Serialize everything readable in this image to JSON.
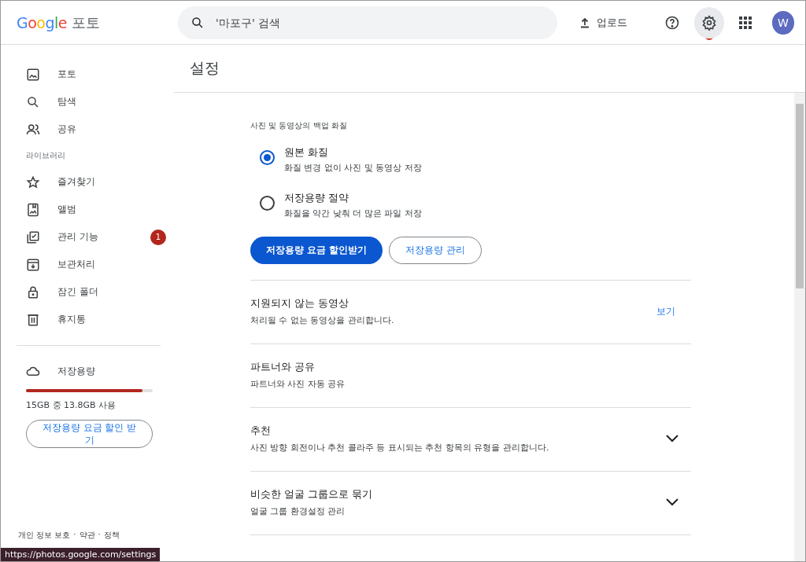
{
  "header": {
    "logo": {
      "brand": "Google",
      "product": "포토"
    },
    "search": {
      "placeholder": "'마포구' 검색"
    },
    "upload": "업로드",
    "icon_buttons": [
      {
        "kind": "help",
        "selected": false
      },
      {
        "kind": "settings",
        "selected": true
      },
      {
        "kind": "apps",
        "selected": false
      }
    ],
    "avatar": "W"
  },
  "sidebar": {
    "items": [
      {
        "kind": "photo",
        "label": "포토",
        "selected": false
      },
      {
        "kind": "search",
        "label": "탐색",
        "selected": false
      },
      {
        "kind": "people",
        "label": "공유",
        "selected": false
      }
    ],
    "library_label": "라이브러리",
    "library_items": [
      {
        "kind": "star",
        "label": "즐겨찾기",
        "selected": false
      },
      {
        "kind": "album",
        "label": "앨범",
        "selected": false
      },
      {
        "kind": "check",
        "label": "관리 기능",
        "selected": false,
        "badge": "1"
      },
      {
        "kind": "archive",
        "label": "보관처리",
        "selected": false
      },
      {
        "kind": "lock",
        "label": "잠긴 폴더",
        "selected": false
      },
      {
        "kind": "trash",
        "label": "휴지통",
        "selected": false
      }
    ],
    "storage": {
      "label": "저장용량",
      "level": 0.92,
      "usage": "15GB 중 13.8GB 사용",
      "button": "저장용량 요금 할인 받기"
    },
    "footer": {
      "links": [
        "개인 정보 보호",
        "약관",
        "정책"
      ],
      "separator": "·"
    }
  },
  "main": {
    "title": "설정",
    "backup": {
      "label": "사진 및 동영상의 백업 화질",
      "options": [
        {
          "title": "원본 화질",
          "description": "화질 변경 없이 사진 및 동영상 저장",
          "selected": true
        },
        {
          "title": "저장용량 절약",
          "description": "화질을 약간 낮춰 더 많은 파일 저장",
          "selected": false
        }
      ],
      "buttons": [
        {
          "kind": "primary",
          "label": "저장용량 요금 할인받기"
        },
        {
          "kind": "outlined",
          "label": "저장용량 관리"
        }
      ]
    },
    "rows": [
      {
        "title": "지원되지 않는 동영상",
        "description": "처리될 수 없는 동영상을 관리합니다.",
        "action": {
          "kind": "link",
          "label": "보기"
        }
      },
      {
        "title": "파트너와 공유",
        "description": "파트너와 사진 자동 공유"
      },
      {
        "title": "추천",
        "description": "사진 방향 회전이나 추천 콜라주 등 표시되는 추천 항목의 유형을 관리합니다.",
        "action": {
          "kind": "expand",
          "expanded": false
        }
      },
      {
        "title": "비슷한 얼굴 그룹으로 묶기",
        "description": "얼굴 그룹 환경설정 관리",
        "action": {
          "kind": "expand",
          "expanded": false
        }
      }
    ]
  },
  "status_url": "https://photos.google.com/settings"
}
